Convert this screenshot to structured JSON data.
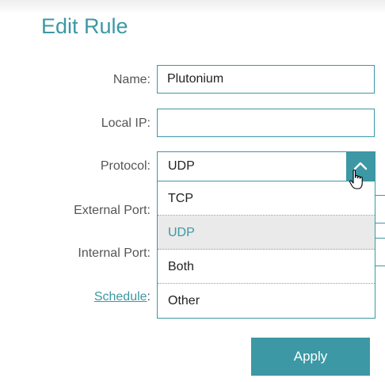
{
  "page": {
    "title": "Edit Rule"
  },
  "form": {
    "name": {
      "label": "Name:",
      "value": "Plutonium"
    },
    "local_ip": {
      "label": "Local IP:",
      "value": ""
    },
    "protocol": {
      "label": "Protocol:",
      "value": "UDP",
      "options": [
        "TCP",
        "UDP",
        "Both",
        "Other"
      ],
      "highlighted": "UDP",
      "expanded": true
    },
    "external_port": {
      "label": "External Port:"
    },
    "internal_port": {
      "label": "Internal Port:"
    },
    "schedule": {
      "link": "Schedule",
      "suffix": ":"
    }
  },
  "actions": {
    "apply_label": "Apply"
  },
  "colors": {
    "accent": "#3c98a4",
    "highlight_bg": "#eaeaea",
    "label_text": "#555555"
  },
  "icons": {
    "dropdown_toggle": "chevron-up-icon",
    "cursor": "hand-pointer-cursor-icon"
  }
}
